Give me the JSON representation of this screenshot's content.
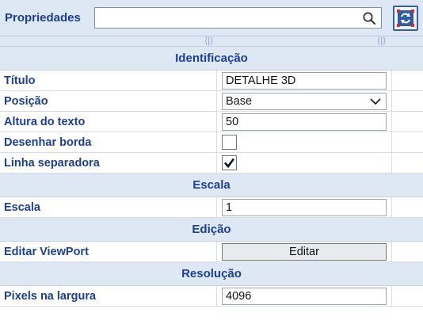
{
  "panel": {
    "title": "Propriedades",
    "search": {
      "value": "",
      "placeholder": ""
    },
    "action_icon": "refresh-icon",
    "splitter_glyph": "⟨|⟩"
  },
  "colors": {
    "header_bg": "#dde8f4",
    "label_blue": "#1c3f94",
    "grid_line": "#d6dde6"
  },
  "sections": [
    {
      "title": "Identificação",
      "rows": [
        {
          "label": "Título",
          "type": "text",
          "value": "DETALHE 3D"
        },
        {
          "label": "Posição",
          "type": "select",
          "value": "Base"
        },
        {
          "label": "Altura do texto",
          "type": "text",
          "value": "50"
        },
        {
          "label": "Desenhar borda",
          "type": "checkbox",
          "checked": false
        },
        {
          "label": "Linha separadora",
          "type": "checkbox",
          "checked": true
        }
      ]
    },
    {
      "title": "Escala",
      "rows": [
        {
          "label": "Escala",
          "type": "text",
          "value": "1"
        }
      ]
    },
    {
      "title": "Edição",
      "rows": [
        {
          "label": "Editar ViewPort",
          "type": "button",
          "value": "Editar"
        }
      ]
    },
    {
      "title": "Resolução",
      "rows": [
        {
          "label": "Pixels na largura",
          "type": "text",
          "value": "4096"
        }
      ]
    }
  ]
}
